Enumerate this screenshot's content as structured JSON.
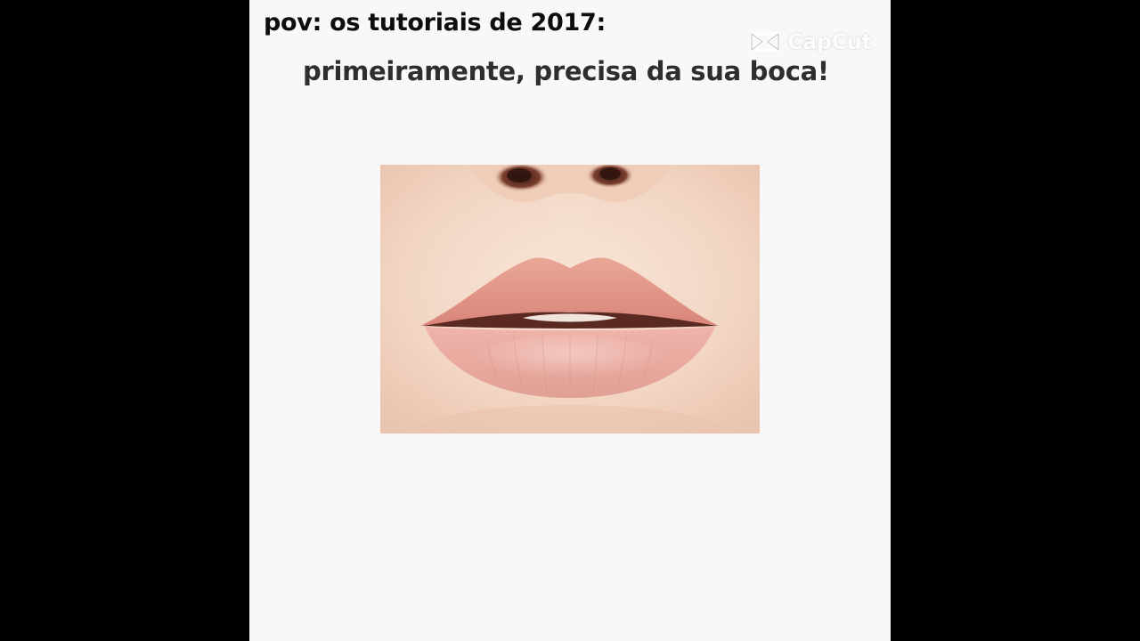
{
  "caption": {
    "top": "pov: os tutoriais de 2017:",
    "subtitle": "primeiramente, precisa da sua boca!"
  },
  "watermark": {
    "icon": "capcut-logo-icon",
    "text": "CapCut"
  },
  "photo": {
    "subject": "lips-photo"
  },
  "colors": {
    "letterbox": "#000000",
    "video_background": "#f8f8f8",
    "caption_text": "#0d0d0d",
    "subtitle_text": "#2e2e2e",
    "skin": "#f3d8c6",
    "lip": "#e9a092"
  }
}
